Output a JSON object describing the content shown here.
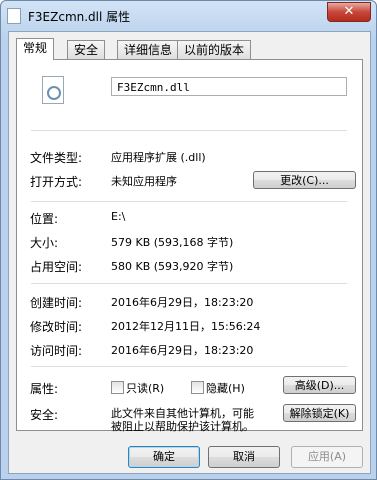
{
  "window": {
    "title": "F3EZcmn.dll 属性",
    "close_label": "✕"
  },
  "tabs": [
    "常规",
    "安全",
    "详细信息",
    "以前的版本"
  ],
  "general": {
    "filename": "F3EZcmn.dll",
    "file_type_label": "文件类型:",
    "file_type_value": "应用程序扩展 (.dll)",
    "opens_with_label": "打开方式:",
    "opens_with_value": "未知应用程序",
    "change_button": "更改(C)...",
    "location_label": "位置:",
    "location_value": "E:\\",
    "size_label": "大小:",
    "size_value": "579 KB (593,168 字节)",
    "size_on_disk_label": "占用空间:",
    "size_on_disk_value": "580 KB (593,920 字节)",
    "created_label": "创建时间:",
    "created_value": "2016年6月29日，18:23:20",
    "modified_label": "修改时间:",
    "modified_value": "2012年12月11日，15:56:24",
    "accessed_label": "访问时间:",
    "accessed_value": "2016年6月29日，18:23:20",
    "attributes_label": "属性:",
    "readonly_label": "只读(R)",
    "hidden_label": "隐藏(H)",
    "advanced_button": "高级(D)...",
    "security_label": "安全:",
    "security_text_line1": "此文件来自其他计算机，可能",
    "security_text_line2": "被阻止以帮助保护该计算机。",
    "unblock_button": "解除锁定(K)"
  },
  "footer": {
    "ok": "确定",
    "cancel": "取消",
    "apply": "应用(A)"
  }
}
